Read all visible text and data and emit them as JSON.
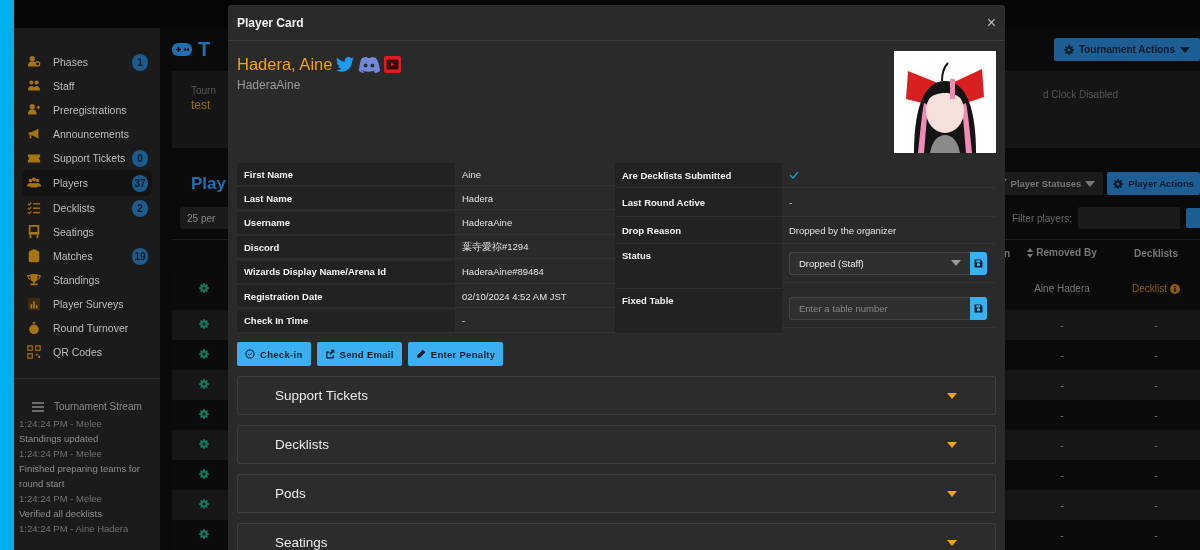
{
  "sidebar": {
    "items": [
      {
        "label": "Phases",
        "badge": "1",
        "selected": false
      },
      {
        "label": "Staff",
        "selected": false
      },
      {
        "label": "Preregistrations",
        "selected": false
      },
      {
        "label": "Announcements",
        "selected": false
      },
      {
        "label": "Support Tickets",
        "badge": "0",
        "selected": false
      },
      {
        "label": "Players",
        "badge": "37",
        "selected": true
      },
      {
        "label": "Decklists",
        "badge": "2",
        "selected": false
      },
      {
        "label": "Seatings",
        "selected": false
      },
      {
        "label": "Matches",
        "badge": "19",
        "selected": false
      },
      {
        "label": "Standings",
        "selected": false
      },
      {
        "label": "Player Surveys",
        "selected": false
      },
      {
        "label": "Round Turnover",
        "selected": false
      },
      {
        "label": "QR Codes",
        "selected": false
      }
    ],
    "stream": {
      "title": "Tournament Stream",
      "entries": [
        {
          "meta": "1:24:24 PM - Melee",
          "text": "Standings updated"
        },
        {
          "meta": "1:24:24 PM - Melee",
          "text": "Finished preparing teams for round start"
        },
        {
          "meta": "1:24:24 PM - Melee",
          "text": "Verified all decklists"
        },
        {
          "meta": "1:24:24 PM - Aine Hadera"
        }
      ]
    }
  },
  "page": {
    "heading": "T",
    "tournament_actions": "Tournament Actions",
    "summary": {
      "label": "Tourn",
      "value": "test",
      "note": "d Clock Disabled"
    },
    "players_heading": "Play",
    "player_statuses": "Player Statuses",
    "player_actions": "Player Actions",
    "page_size": "25 per",
    "filter_label": "Filter players:",
    "columns": [
      {
        "label": "n",
        "sortable": false
      },
      {
        "label": "Removed By",
        "sortable": true
      },
      {
        "label": "Decklists",
        "sortable": false
      }
    ],
    "rows": [
      {
        "removed_by": "Aine Hadera",
        "decklist": "Decklist",
        "link": true
      },
      {
        "removed_by": "-",
        "decklist": "-",
        "link": false
      },
      {
        "removed_by": "-",
        "decklist": "-",
        "link": false
      },
      {
        "removed_by": "-",
        "decklist": "-",
        "link": false
      },
      {
        "removed_by": "-",
        "decklist": "-",
        "link": false
      },
      {
        "removed_by": "-",
        "decklist": "-",
        "link": false
      },
      {
        "removed_by": "-",
        "decklist": "-",
        "link": false
      },
      {
        "removed_by": "-",
        "decklist": "-",
        "link": false
      },
      {
        "removed_by": "-",
        "decklist": "-",
        "link": false
      }
    ]
  },
  "modal": {
    "title": "Player Card",
    "close": "×",
    "name": "Hadera, Aine",
    "username": "HaderaAine",
    "details": [
      {
        "label": "First Name",
        "value": "Aine"
      },
      {
        "label": "Last Name",
        "value": "Hadera"
      },
      {
        "label": "Username",
        "value": "HaderaAine"
      },
      {
        "label": "Discord",
        "value": "葉寺愛祢#1294"
      },
      {
        "label": "Wizards Display Name/Arena Id",
        "value": "HaderaAine#89484"
      },
      {
        "label": "Registration Date",
        "value": "02/10/2024 4:52 AM JST"
      },
      {
        "label": "Check In Time",
        "value": "-"
      }
    ],
    "status_fields": [
      {
        "label": "Are Decklists Submitted",
        "kind": "check",
        "checked": true
      },
      {
        "label": "Last Round Active",
        "kind": "text",
        "value": "-"
      },
      {
        "label": "Drop Reason",
        "kind": "text",
        "value": "Dropped by the organizer"
      },
      {
        "label": "Status",
        "kind": "select",
        "value": "Dropped (Staff)"
      },
      {
        "label": "Fixed Table",
        "kind": "input",
        "placeholder": "Enter a table number"
      }
    ],
    "actions": [
      "Check-in",
      "Send Email",
      "Enter Penalty"
    ],
    "sections": [
      {
        "title": "Support Tickets"
      },
      {
        "title": "Decklists"
      },
      {
        "title": "Pods"
      },
      {
        "title": "Seatings"
      }
    ]
  }
}
